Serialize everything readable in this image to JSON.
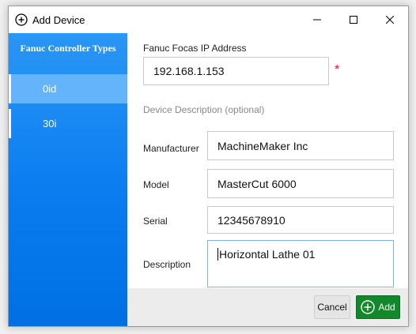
{
  "window": {
    "title": "Add Device"
  },
  "sidebar": {
    "header": "Fanuc Controller Types",
    "items": [
      {
        "label": "0id",
        "selected": true
      },
      {
        "label": "30i",
        "selected": false
      }
    ]
  },
  "form": {
    "ip_label": "Fanuc Focas IP Address",
    "ip_value": "192.168.1.153",
    "required_mark": "*",
    "desc_section": "Device Description (optional)",
    "manufacturer_label": "Manufacturer",
    "manufacturer_value": "MachineMaker Inc",
    "model_label": "Model",
    "model_value": "MasterCut 6000",
    "serial_label": "Serial",
    "serial_value": "12345678910",
    "description_label": "Description",
    "description_value": "Horizontal Lathe 01"
  },
  "footer": {
    "cancel_label": "Cancel",
    "add_label": "Add"
  },
  "colors": {
    "sidebar": "#0a7cf0",
    "selected": "#63b4fa",
    "add_button": "#11882a",
    "required": "#e81123",
    "focus_border": "#7eb4ea"
  }
}
